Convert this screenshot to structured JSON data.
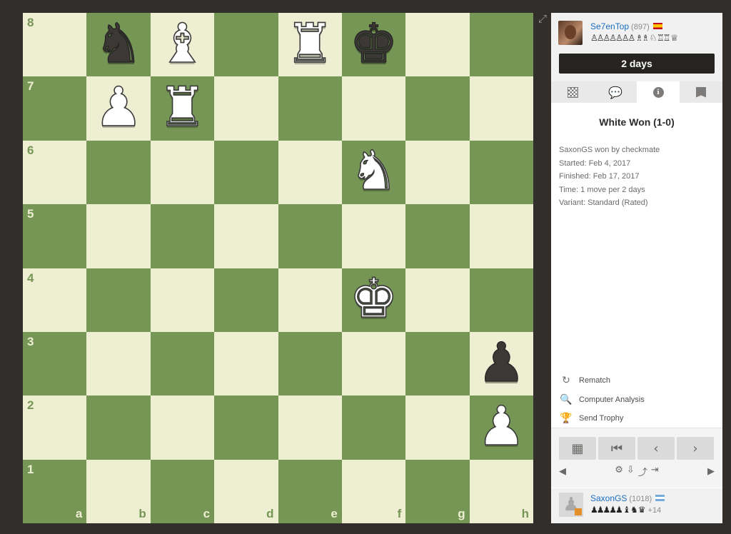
{
  "board": {
    "files": [
      "a",
      "b",
      "c",
      "d",
      "e",
      "f",
      "g",
      "h"
    ],
    "ranks": [
      "8",
      "7",
      "6",
      "5",
      "4",
      "3",
      "2",
      "1"
    ],
    "colors": {
      "light": "#eeeed2",
      "dark": "#769656"
    },
    "pieces": [
      {
        "square": "b8",
        "type": "knight",
        "color": "black",
        "glyph": "♞"
      },
      {
        "square": "c8",
        "type": "bishop",
        "color": "white",
        "glyph": "♝"
      },
      {
        "square": "e8",
        "type": "rook",
        "color": "white",
        "glyph": "♜"
      },
      {
        "square": "f8",
        "type": "king",
        "color": "black",
        "glyph": "♚"
      },
      {
        "square": "b7",
        "type": "pawn",
        "color": "white",
        "glyph": "♟"
      },
      {
        "square": "c7",
        "type": "rook",
        "color": "white",
        "glyph": "♜"
      },
      {
        "square": "f6",
        "type": "knight",
        "color": "white",
        "glyph": "♞"
      },
      {
        "square": "f4",
        "type": "king",
        "color": "white",
        "glyph": "♚"
      },
      {
        "square": "h3",
        "type": "pawn",
        "color": "black",
        "glyph": "♟"
      },
      {
        "square": "h2",
        "type": "pawn",
        "color": "white",
        "glyph": "♟"
      }
    ]
  },
  "top_player": {
    "name": "Se7enTop",
    "rating": "(897)",
    "flag": "flag-es",
    "captured": "♙♙♙♙♙♙♙ ♗♗ ♘ ♖♖ ♕",
    "timer": "2 days"
  },
  "tabs": [
    {
      "name": "board-icon",
      "label": ""
    },
    {
      "name": "chat-icon",
      "label": "💬"
    },
    {
      "name": "info-icon",
      "label": "i"
    },
    {
      "name": "notes-icon",
      "label": ""
    }
  ],
  "info": {
    "result": "White Won (1-0)",
    "lines": [
      "SaxonGS won by checkmate",
      "Started: Feb 4, 2017",
      "Finished: Feb 17, 2017",
      "Time: 1 move per 2 days",
      "Variant: Standard (Rated)"
    ]
  },
  "actions": [
    {
      "name": "rematch",
      "icon": "↻",
      "label": "Rematch"
    },
    {
      "name": "computer-analysis",
      "icon": "🔍",
      "label": "Computer Analysis"
    },
    {
      "name": "send-trophy",
      "icon": "🏆",
      "label": "Send Trophy"
    }
  ],
  "nav_buttons": [
    {
      "name": "analysis-board-button",
      "glyph": "▦"
    },
    {
      "name": "first-move-button",
      "glyph": "⏮"
    },
    {
      "name": "previous-move-button",
      "glyph": "‹"
    },
    {
      "name": "next-move-button",
      "glyph": "›"
    }
  ],
  "tools": {
    "left": "◀",
    "right": "▶",
    "middle": [
      "⚙",
      "⇩",
      "⤴",
      "⇥"
    ]
  },
  "bottom_player": {
    "name": "SaxonGS",
    "rating": "(1018)",
    "flag": "flag-ar",
    "captured": "♟♟♟♟♟ ♝ ♞ ♛",
    "plus": "+14"
  }
}
